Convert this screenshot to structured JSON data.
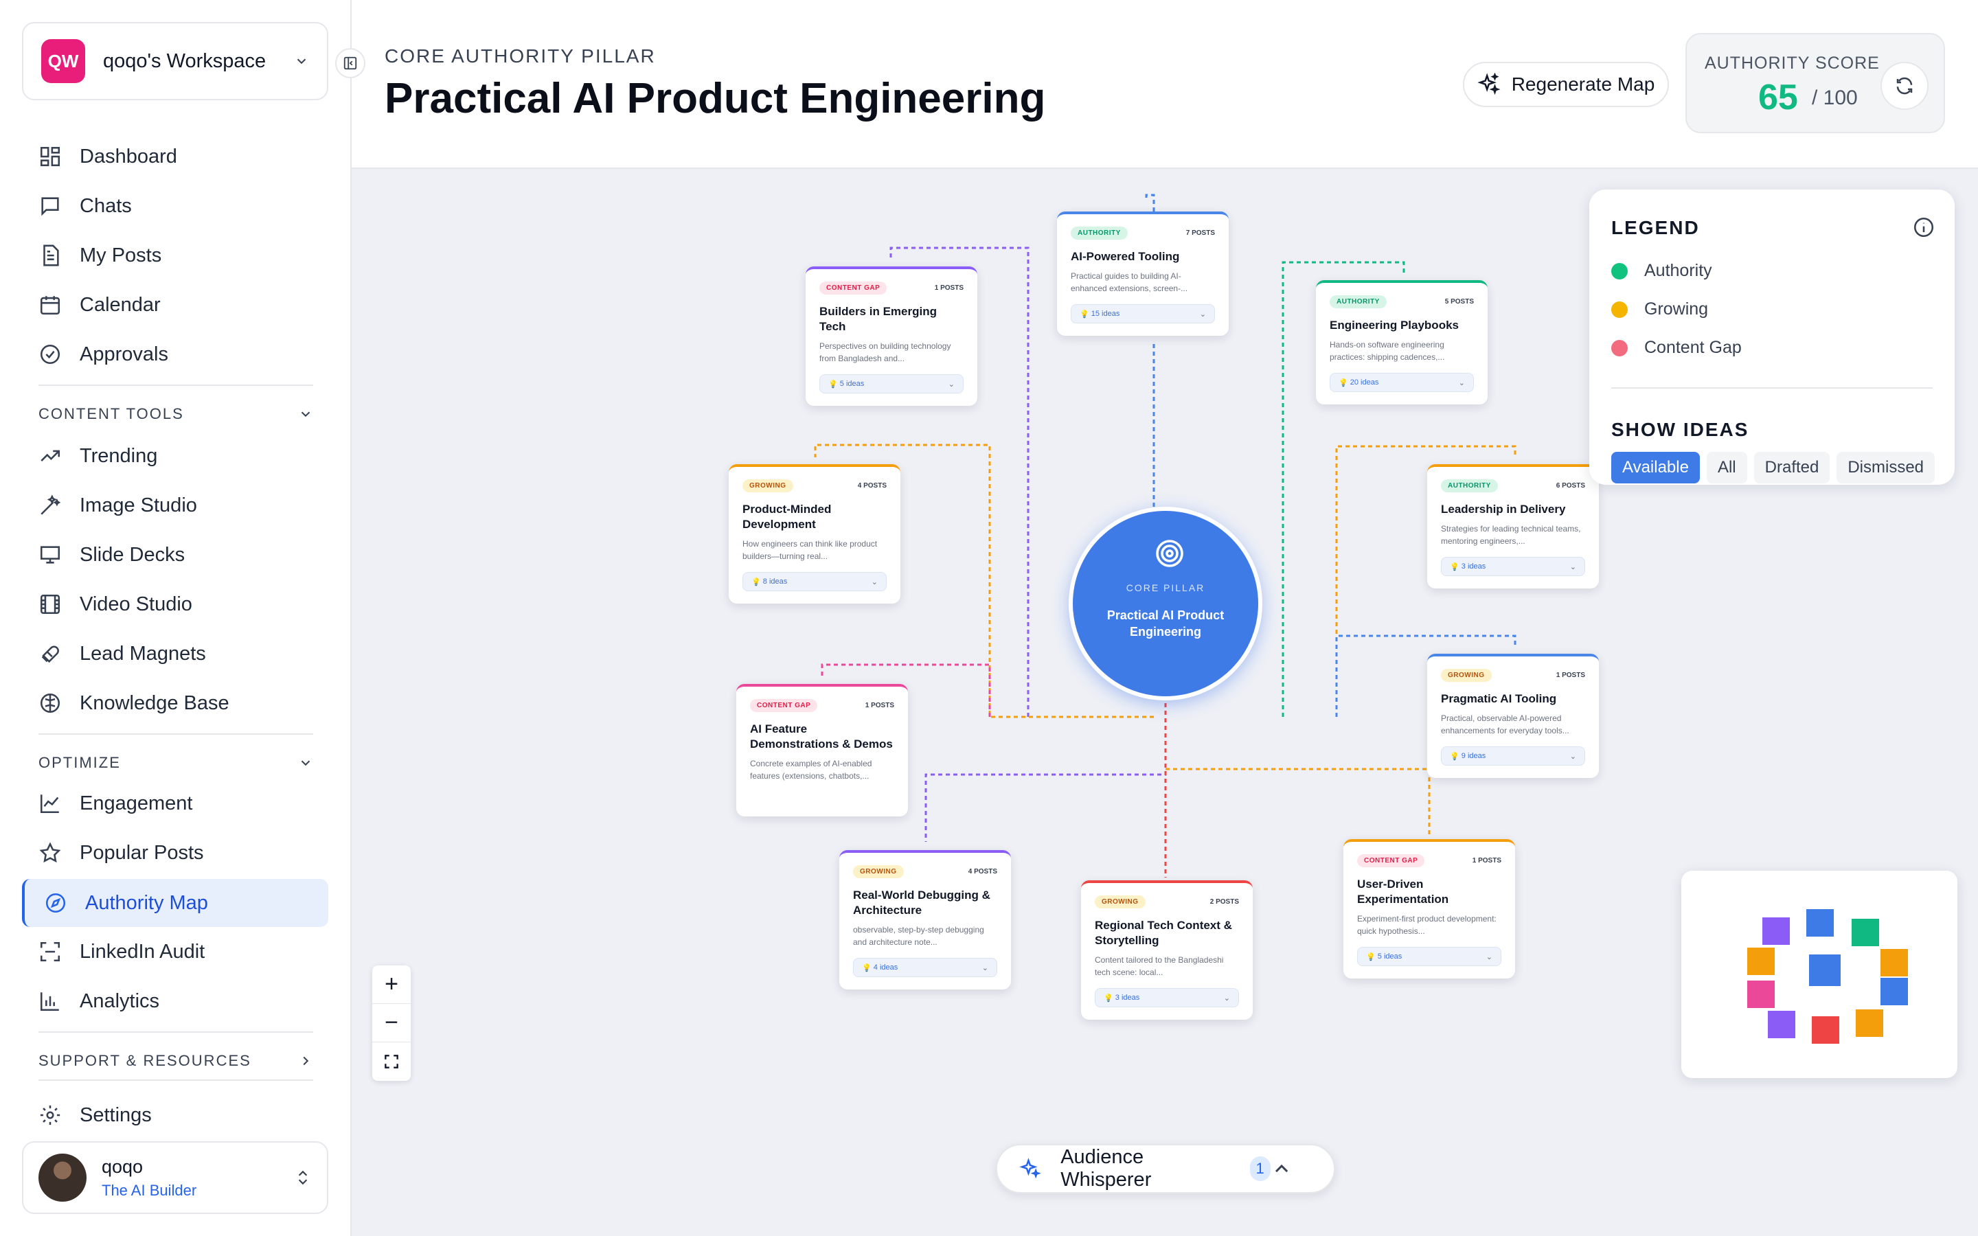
{
  "workspace": {
    "initials": "QW",
    "name": "qoqo's Workspace"
  },
  "nav_main": [
    {
      "label": "Dashboard",
      "icon": "grid-icon"
    },
    {
      "label": "Chats",
      "icon": "chat-icon"
    },
    {
      "label": "My Posts",
      "icon": "document-icon"
    },
    {
      "label": "Calendar",
      "icon": "calendar-icon"
    },
    {
      "label": "Approvals",
      "icon": "check-circle-icon"
    }
  ],
  "sections": {
    "content_tools": "CONTENT TOOLS",
    "optimize": "OPTIMIZE",
    "support": "SUPPORT & RESOURCES"
  },
  "nav_content_tools": [
    {
      "label": "Trending",
      "icon": "trending-icon"
    },
    {
      "label": "Image Studio",
      "icon": "magic-wand-icon"
    },
    {
      "label": "Slide Decks",
      "icon": "presentation-icon"
    },
    {
      "label": "Video Studio",
      "icon": "film-icon"
    },
    {
      "label": "Lead Magnets",
      "icon": "magnet-icon"
    },
    {
      "label": "Knowledge Base",
      "icon": "brain-icon"
    }
  ],
  "nav_optimize": [
    {
      "label": "Engagement",
      "icon": "line-chart-icon"
    },
    {
      "label": "Popular Posts",
      "icon": "star-icon"
    },
    {
      "label": "Authority Map",
      "icon": "compass-icon",
      "active": true
    },
    {
      "label": "LinkedIn Audit",
      "icon": "scan-icon"
    },
    {
      "label": "Analytics",
      "icon": "bar-chart-icon"
    }
  ],
  "settings_label": "Settings",
  "user": {
    "name": "qoqo",
    "subtitle": "The AI Builder"
  },
  "header": {
    "kicker": "CORE AUTHORITY PILLAR",
    "title": "Practical AI Product Engineering",
    "regenerate_label": "Regenerate Map",
    "score_label": "AUTHORITY SCORE",
    "score_value": "65",
    "score_max": "/ 100"
  },
  "pillar": {
    "kicker": "CORE PILLAR",
    "name": "Practical AI Product Engineering"
  },
  "cards": [
    {
      "id": "builders",
      "status": "CONTENT GAP",
      "posts": "1 POSTS",
      "title": "Builders in Emerging Tech",
      "desc": "Perspectives on building technology from Bangladesh and...",
      "ideas": "5 ideas"
    },
    {
      "id": "tooling",
      "status": "AUTHORITY",
      "posts": "7 POSTS",
      "title": "AI-Powered Tooling",
      "desc": "Practical guides to building AI-enhanced extensions, screen-...",
      "ideas": "15 ideas"
    },
    {
      "id": "playbooks",
      "status": "AUTHORITY",
      "posts": "5 POSTS",
      "title": "Engineering Playbooks",
      "desc": "Hands-on software engineering practices: shipping cadences,...",
      "ideas": "20 ideas"
    },
    {
      "id": "product",
      "status": "GROWING",
      "posts": "4 POSTS",
      "title": "Product-Minded Development",
      "desc": "How engineers can think like product builders—turning real...",
      "ideas": "8 ideas"
    },
    {
      "id": "leadership",
      "status": "AUTHORITY",
      "posts": "6 POSTS",
      "title": "Leadership in Delivery",
      "desc": "Strategies for leading technical teams, mentoring engineers,...",
      "ideas": "3 ideas"
    },
    {
      "id": "demos",
      "status": "CONTENT GAP",
      "posts": "1 POSTS",
      "title": "AI Feature Demonstrations & Demos",
      "desc": "Concrete examples of AI-enabled features (extensions, chatbots,...",
      "ideas": ""
    },
    {
      "id": "pragmatic",
      "status": "GROWING",
      "posts": "1 POSTS",
      "title": "Pragmatic AI Tooling",
      "desc": "Practical, observable AI-powered enhancements for everyday tools...",
      "ideas": "9 ideas"
    },
    {
      "id": "debugging",
      "status": "GROWING",
      "posts": "4 POSTS",
      "title": "Real-World Debugging & Architecture",
      "desc": "observable, step-by-step debugging and architecture note...",
      "ideas": "4 ideas"
    },
    {
      "id": "regional",
      "status": "GROWING",
      "posts": "2 POSTS",
      "title": "Regional Tech Context & Storytelling",
      "desc": "Content tailored to the Bangladeshi tech scene: local...",
      "ideas": "3 ideas"
    },
    {
      "id": "experiment",
      "status": "CONTENT GAP",
      "posts": "1 POSTS",
      "title": "User-Driven Experimentation",
      "desc": "Experiment-first product development: quick hypothesis...",
      "ideas": "5 ideas"
    }
  ],
  "legend": {
    "title": "LEGEND",
    "items": [
      {
        "label": "Authority",
        "color": "#10c27e"
      },
      {
        "label": "Growing",
        "color": "#f5b400"
      },
      {
        "label": "Content Gap",
        "color": "#f26b7f"
      }
    ],
    "show_title": "SHOW IDEAS",
    "filters": [
      "Available",
      "All",
      "Drafted",
      "Dismissed"
    ],
    "active_filter": "Available"
  },
  "audience": {
    "label": "Audience Whisperer",
    "count": "1"
  },
  "colors": {
    "accent": "#3f7be6",
    "authority": "#10b981"
  }
}
